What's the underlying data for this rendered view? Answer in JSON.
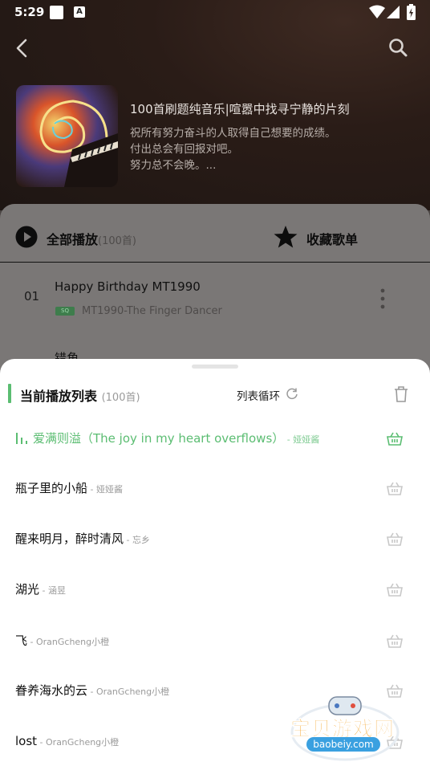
{
  "status_bar": {
    "time": "5:29",
    "a_icon": "A"
  },
  "playlist": {
    "title": "100首刷题纯音乐|喧嚣中找寻宁静的片刻",
    "description": [
      "祝所有努力奋斗的人取得自己想要的成绩。",
      "付出总会有回报对吧。",
      "努力总不会晚。..."
    ]
  },
  "actions": {
    "play_all": "全部播放",
    "play_all_count": "(100首)",
    "favorite": "收藏歌单"
  },
  "song_list": [
    {
      "index": "01",
      "title": "Happy Birthday MT1990",
      "badge": "SQ",
      "artist": "MT1990-The Finger Dancer"
    },
    {
      "title": "错角"
    }
  ],
  "queue_sheet": {
    "title": "当前播放列表",
    "count": "(100首)",
    "loop_mode": "列表循环",
    "accent_color": "#5bbd72",
    "items": [
      {
        "title": "爱满则溢（The joy in my heart overflows）",
        "artist": " - 娅娅酱",
        "active": true
      },
      {
        "title": "瓶子里的小船",
        "artist": " - 娅娅酱"
      },
      {
        "title": "醒来明月，醉时清风",
        "artist": " - 忘乡"
      },
      {
        "title": "湖光",
        "artist": " - 涵昱"
      },
      {
        "title": "飞",
        "artist": " - OranGcheng小橙"
      },
      {
        "title": "眷养海水的云",
        "artist": " - OranGcheng小橙"
      },
      {
        "title": "lost",
        "artist": " - OranGcheng小橙"
      }
    ]
  },
  "watermark": {
    "text": "宝贝游戏网",
    "url": "baobeiy.com"
  }
}
